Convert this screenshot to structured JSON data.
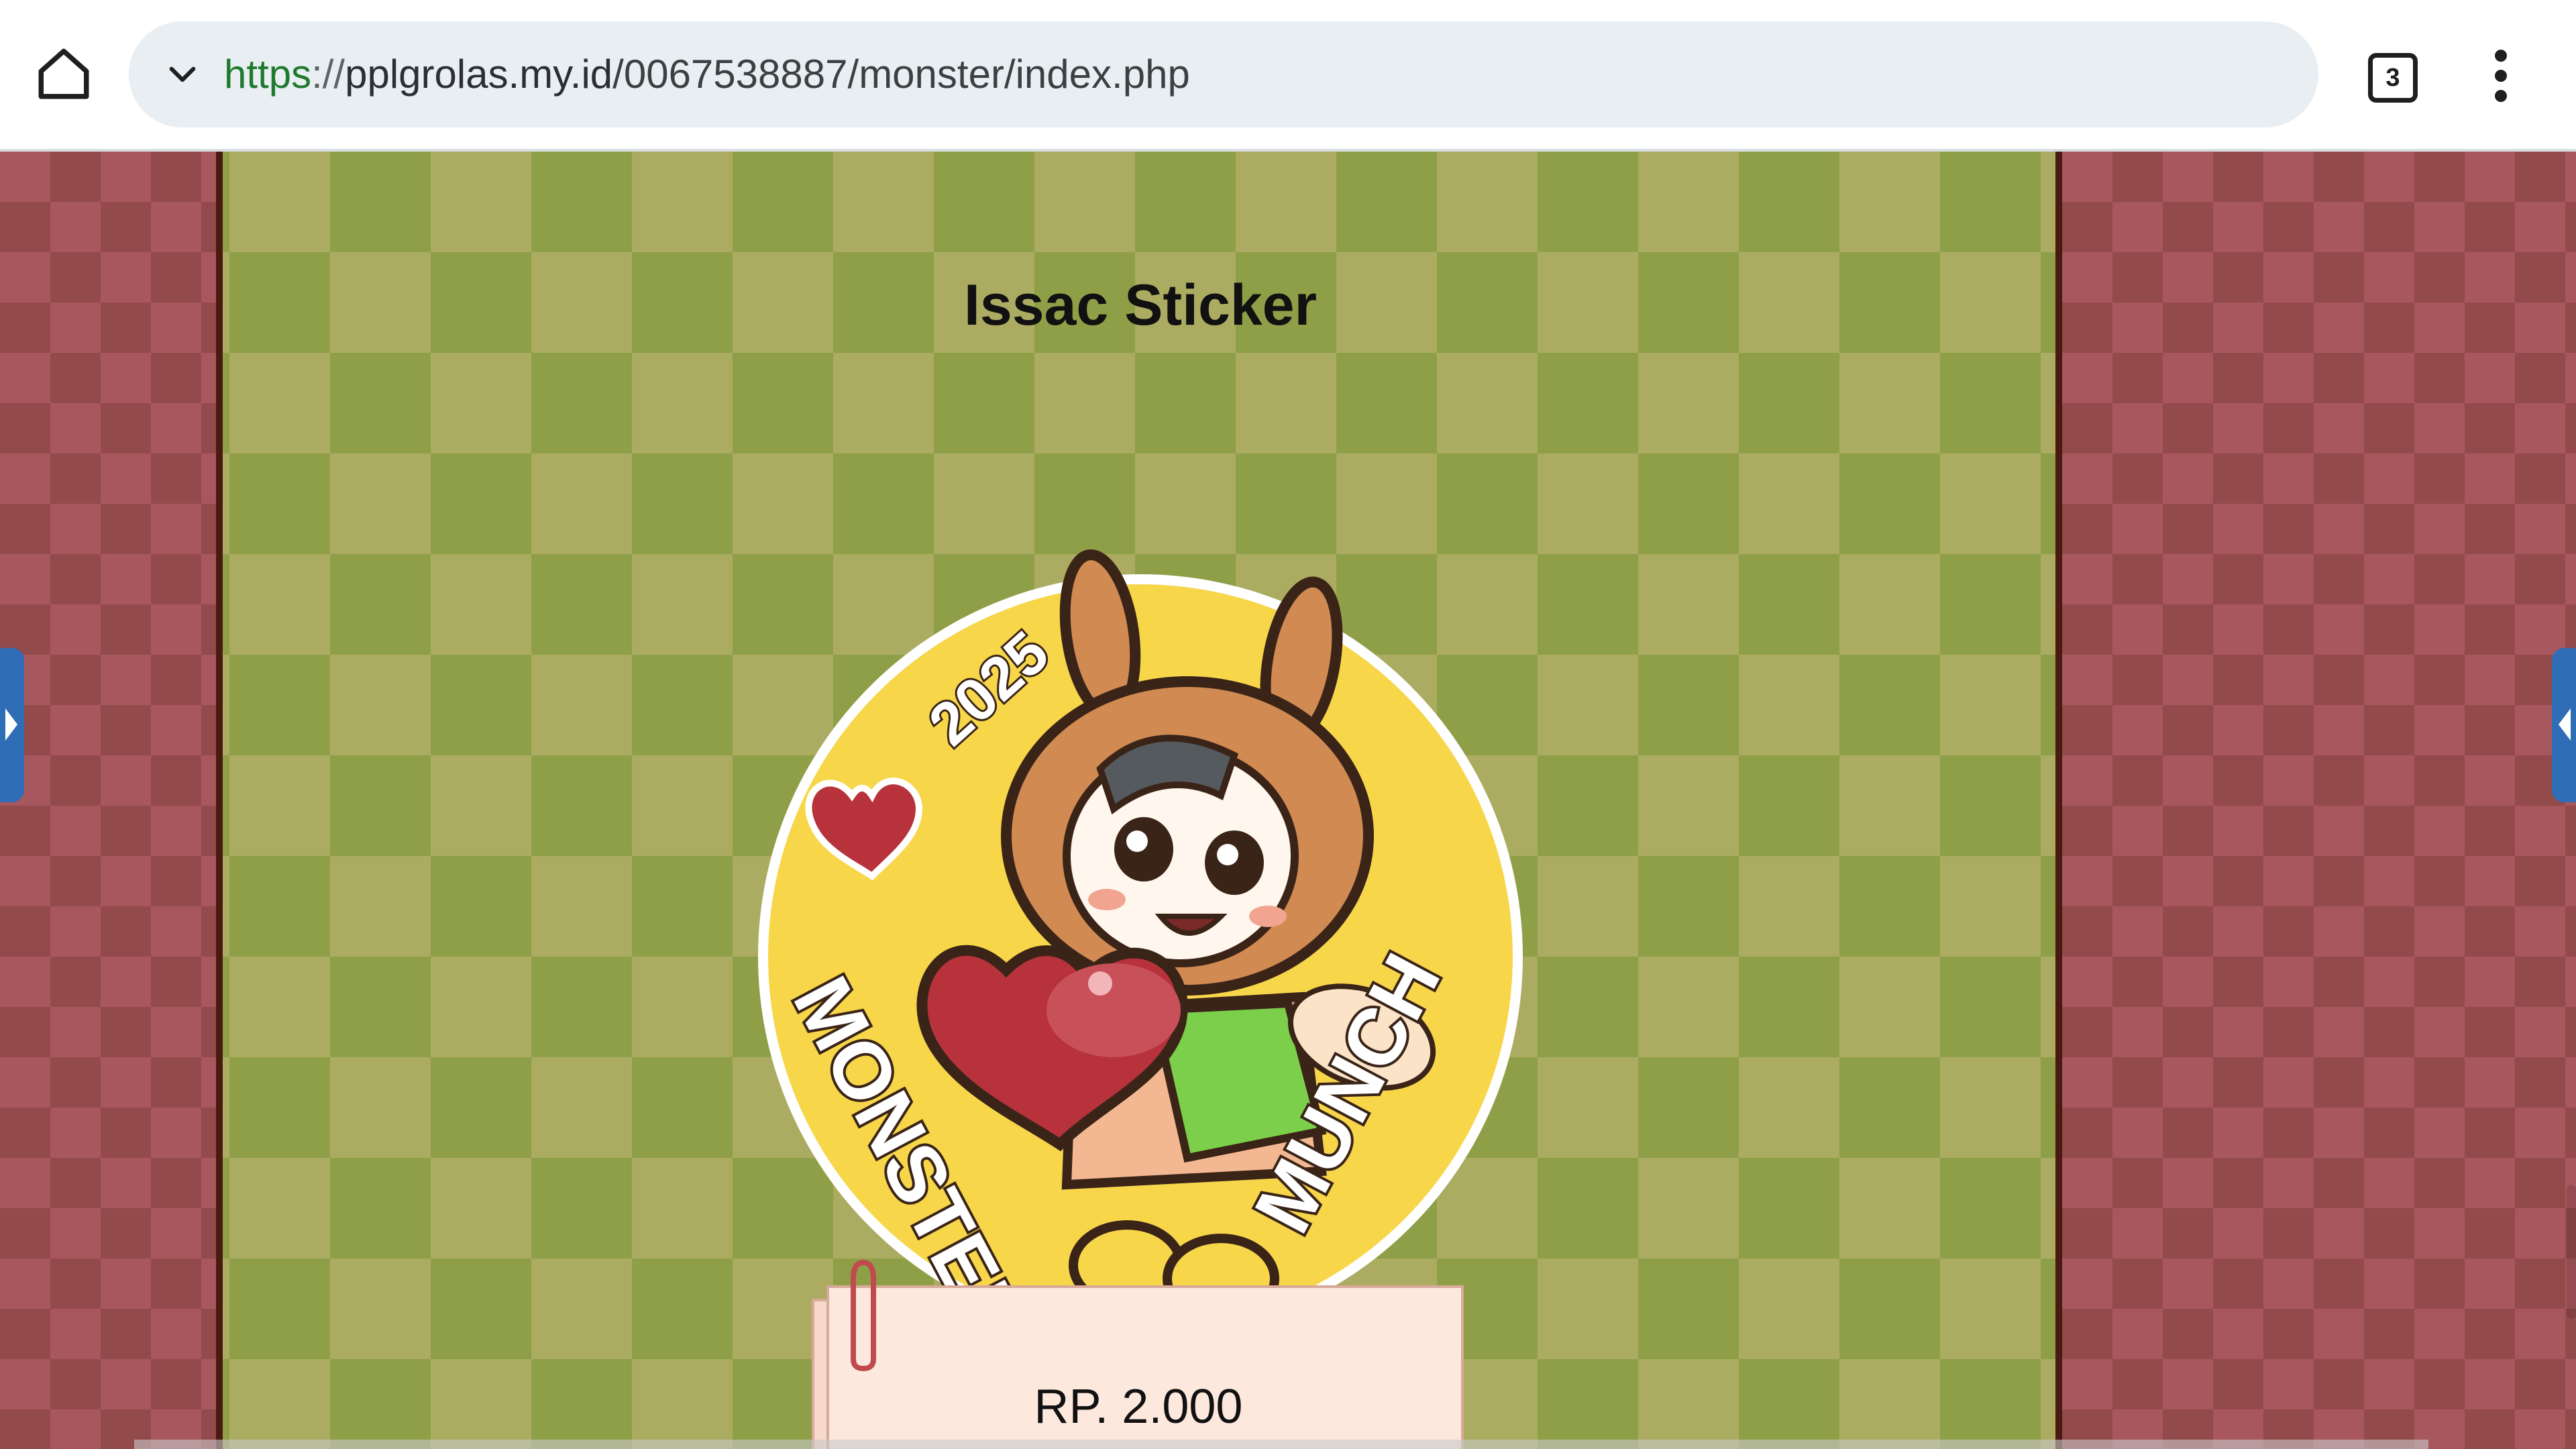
{
  "browser": {
    "url": {
      "scheme": "https",
      "separator": "://",
      "host": "pplgrolas.my.id",
      "path": "/0067538887/monster/index.php"
    },
    "tab_count": "3",
    "icons": {
      "home": "home-icon",
      "dropdown": "chevron-down-icon",
      "tabs": "tab-switcher-icon",
      "menu": "more-vert-icon"
    }
  },
  "product": {
    "title": "Issac Sticker",
    "sticker_text": {
      "year": "2025",
      "left_word": "MONSTER",
      "right_word": "MUNCH"
    },
    "price": "RP. 2.000"
  },
  "colors": {
    "panel_check_light": "#abac62",
    "panel_check_dark": "#8f9f47",
    "side_check_light": "#a9575f",
    "side_check_dark": "#934a4b",
    "sticker_yellow": "#f7d64a",
    "heart_red": "#b8323c",
    "price_card": "#fde8de",
    "url_scheme": "#1f7a2e"
  }
}
